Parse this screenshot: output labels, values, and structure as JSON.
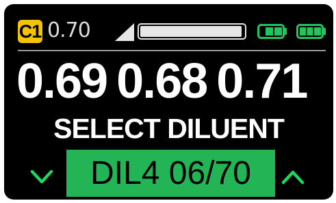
{
  "status_bar": {
    "channel": "C1",
    "reading": "0.70",
    "progress": 0.98,
    "batteries": [
      {
        "name": "battery-1",
        "color": "#22c55e",
        "bars": 2
      },
      {
        "name": "battery-2",
        "color": "#22c55e",
        "bars": 3
      }
    ]
  },
  "readings": [
    "0.69",
    "0.68",
    "0.71"
  ],
  "prompt": "SELECT DILUENT",
  "selector": {
    "value": "DIL4 06/70",
    "down_icon": "chevron-down-icon",
    "up_icon": "chevron-up-icon"
  },
  "colors": {
    "background": "#000000",
    "badge": "#f5c400",
    "accent": "#22b455",
    "arrow": "#1ed760"
  }
}
